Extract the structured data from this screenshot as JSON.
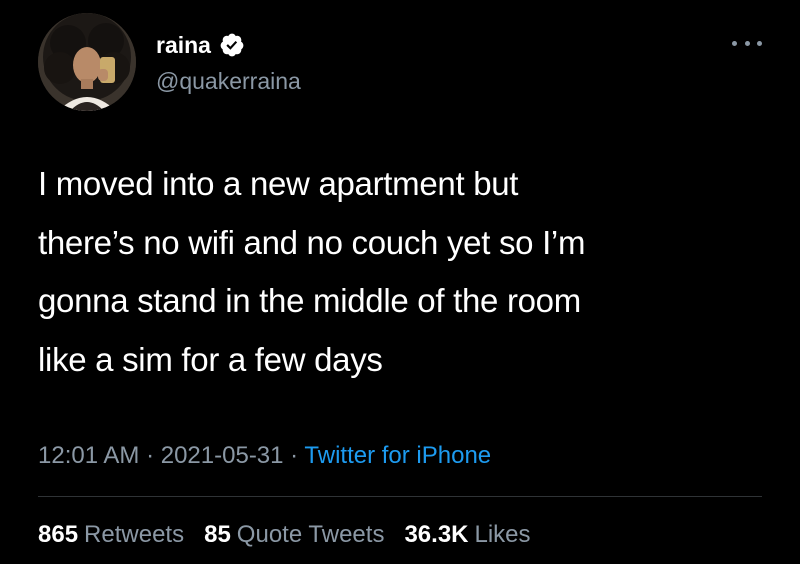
{
  "user": {
    "display_name": "raina",
    "handle": "@quakerraina",
    "verified": true
  },
  "tweet": {
    "lines": [
      "I moved into a new apartment but",
      "there’s no wifi and no couch yet so I’m",
      "gonna stand in the middle of the room",
      "like a sim for a few days"
    ],
    "time": "12:01 AM",
    "date": "2021-05-31",
    "source": "Twitter for iPhone",
    "separator": " · "
  },
  "stats": {
    "retweets_count": "865",
    "retweets_label": "Retweets",
    "quotes_count": "85",
    "quotes_label": "Quote Tweets",
    "likes_count": "36.3K",
    "likes_label": "Likes"
  },
  "icons": {
    "verified": "verified-badge-icon",
    "more": "more-horizontal-icon"
  },
  "colors": {
    "background": "#000000",
    "text": "#ffffff",
    "secondary": "#8b98a5",
    "link": "#1d9bf0"
  }
}
